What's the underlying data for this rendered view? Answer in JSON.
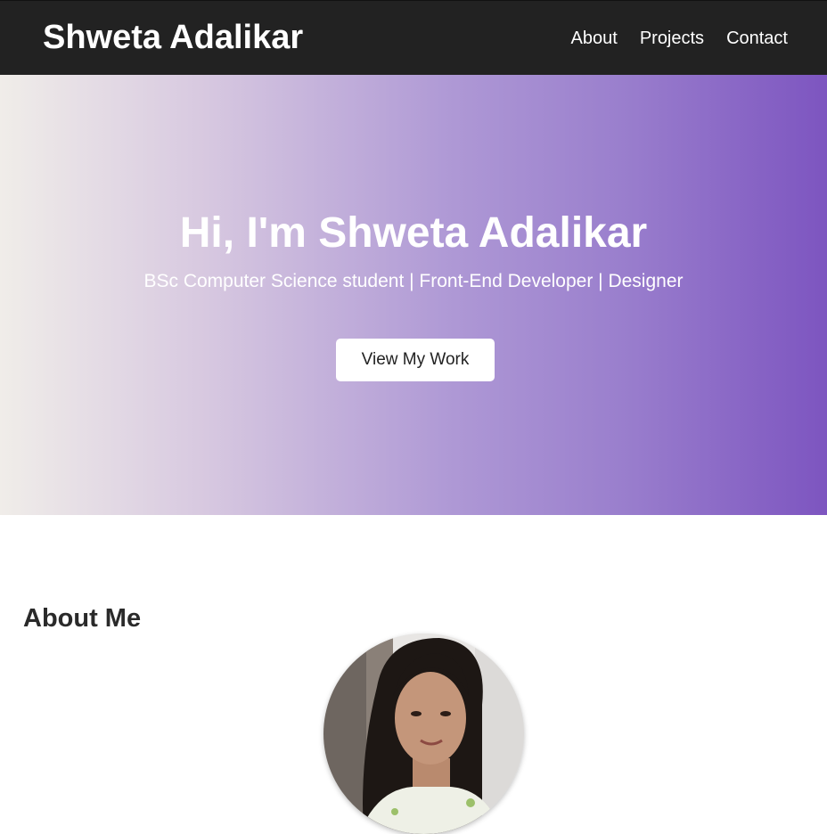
{
  "header": {
    "brand": "Shweta Adalikar",
    "nav": [
      "About",
      "Projects",
      "Contact"
    ]
  },
  "hero": {
    "title": "Hi, I'm Shweta Adalikar",
    "subtitle": "BSc Computer Science student | Front-End Developer | Designer",
    "button_label": "View My Work"
  },
  "about": {
    "title": "About Me"
  },
  "colors": {
    "navbar_bg": "#222222",
    "gradient_start": "#f0ede9",
    "gradient_end": "#7d55c0"
  }
}
